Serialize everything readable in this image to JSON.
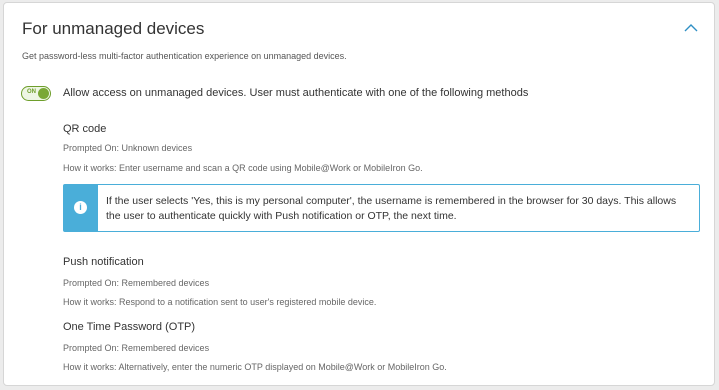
{
  "section": {
    "title": "For unmanaged devices",
    "description": "Get password-less multi-factor authentication experience on unmanaged devices.",
    "collapse_icon": "chevron-up-icon",
    "accent_color": "#4aaed9",
    "toggle": {
      "state_label": "ON",
      "checked": true,
      "color": "#7aa835",
      "text": "Allow access on unmanaged devices. User must authenticate with one of the following methods"
    }
  },
  "methods": [
    {
      "name": "QR code",
      "prompted_on": "Prompted On: Unknown devices",
      "how_it_works": "How it works: Enter username and scan a QR code using Mobile@Work or MobileIron Go."
    },
    {
      "name": "Push notification",
      "prompted_on": "Prompted On: Remembered devices",
      "how_it_works": "How it works: Respond to a notification sent to user's registered mobile device."
    },
    {
      "name": "One Time Password (OTP)",
      "prompted_on": "Prompted On: Remembered devices",
      "how_it_works": "How it works: Alternatively, enter the numeric OTP displayed on Mobile@Work or MobileIron Go."
    }
  ],
  "info": {
    "icon": "info-icon",
    "icon_glyph": "i",
    "text": "If the user selects 'Yes, this is my personal computer', the username is remembered in the browser for 30 days. This allows the user to authenticate quickly with Push notification or OTP, the next time."
  }
}
